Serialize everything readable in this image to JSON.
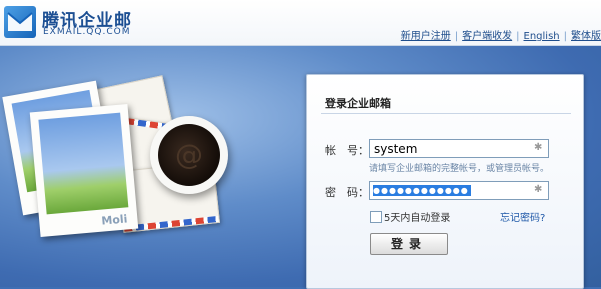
{
  "header": {
    "logo_title": "腾讯企业邮",
    "logo_subtitle": "EXMAIL.QQ.COM",
    "links": [
      "新用户注册",
      "客户端收发",
      "English",
      "繁体版"
    ]
  },
  "illustration": {
    "photo_brand": "Moli",
    "cup_symbol": "@"
  },
  "login": {
    "title": "登录企业邮箱",
    "account_label": "帐　号：",
    "account_value": "system",
    "account_hint": "请填写企业邮箱的完整帐号，或管理员帐号。",
    "password_label": "密　码：",
    "password_mask": "●●●●●●●●●●●●",
    "remember_label": "5天内自动登录",
    "remember_checked": false,
    "forgot_label": "忘记密码?",
    "submit_label": "登录"
  },
  "colors": {
    "brand_blue": "#1c4f93",
    "background": "#3f6fb4",
    "selection": "#2a7de1"
  }
}
